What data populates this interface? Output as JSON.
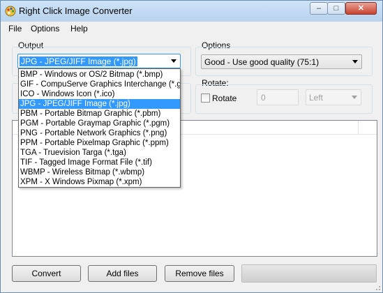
{
  "window": {
    "title": "Right Click Image Converter",
    "app_icon": "palette-icon",
    "controls": {
      "minimize": "–",
      "maximize": "□",
      "close": "✕"
    }
  },
  "menu": {
    "items": [
      "File",
      "Options",
      "Help"
    ]
  },
  "output": {
    "label": "Output",
    "selected": "JPG - JPEG/JIFF Image (*.jpg)",
    "options": [
      "BMP - Windows or OS/2 Bitmap (*.bmp)",
      "GIF - CompuServe Graphics Interchange (*.gif)",
      "ICO - Windows Icon (*.ico)",
      "JPG - JPEG/JIFF Image (*.jpg)",
      "PBM - Portable Bitmap Graphic (*.pbm)",
      "PGM - Portable Graymap Graphic (*.pgm)",
      "PNG - Portable Network Graphics (*.png)",
      "PPM - Portable Pixelmap Graphic (*.ppm)",
      "TGA - Truevision Targa (*.tga)",
      "TIF - Tagged Image Format File (*.tif)",
      "WBMP - Wireless Bitmap (*.wbmp)",
      "XPM - X Windows Pixmap (*.xpm)"
    ],
    "selected_index": 3
  },
  "options": {
    "label": "Options",
    "quality": "Good - Use good quality (75:1)"
  },
  "rotate": {
    "label": "Rotate:",
    "checkbox_label": "Rotate",
    "checked": false,
    "angle": "0",
    "direction": "Left"
  },
  "buttons": {
    "convert": "Convert",
    "add_files": "Add files",
    "remove_files": "Remove files"
  },
  "colors": {
    "highlight": "#3399ff",
    "window_bg": "#f0f0f0"
  }
}
